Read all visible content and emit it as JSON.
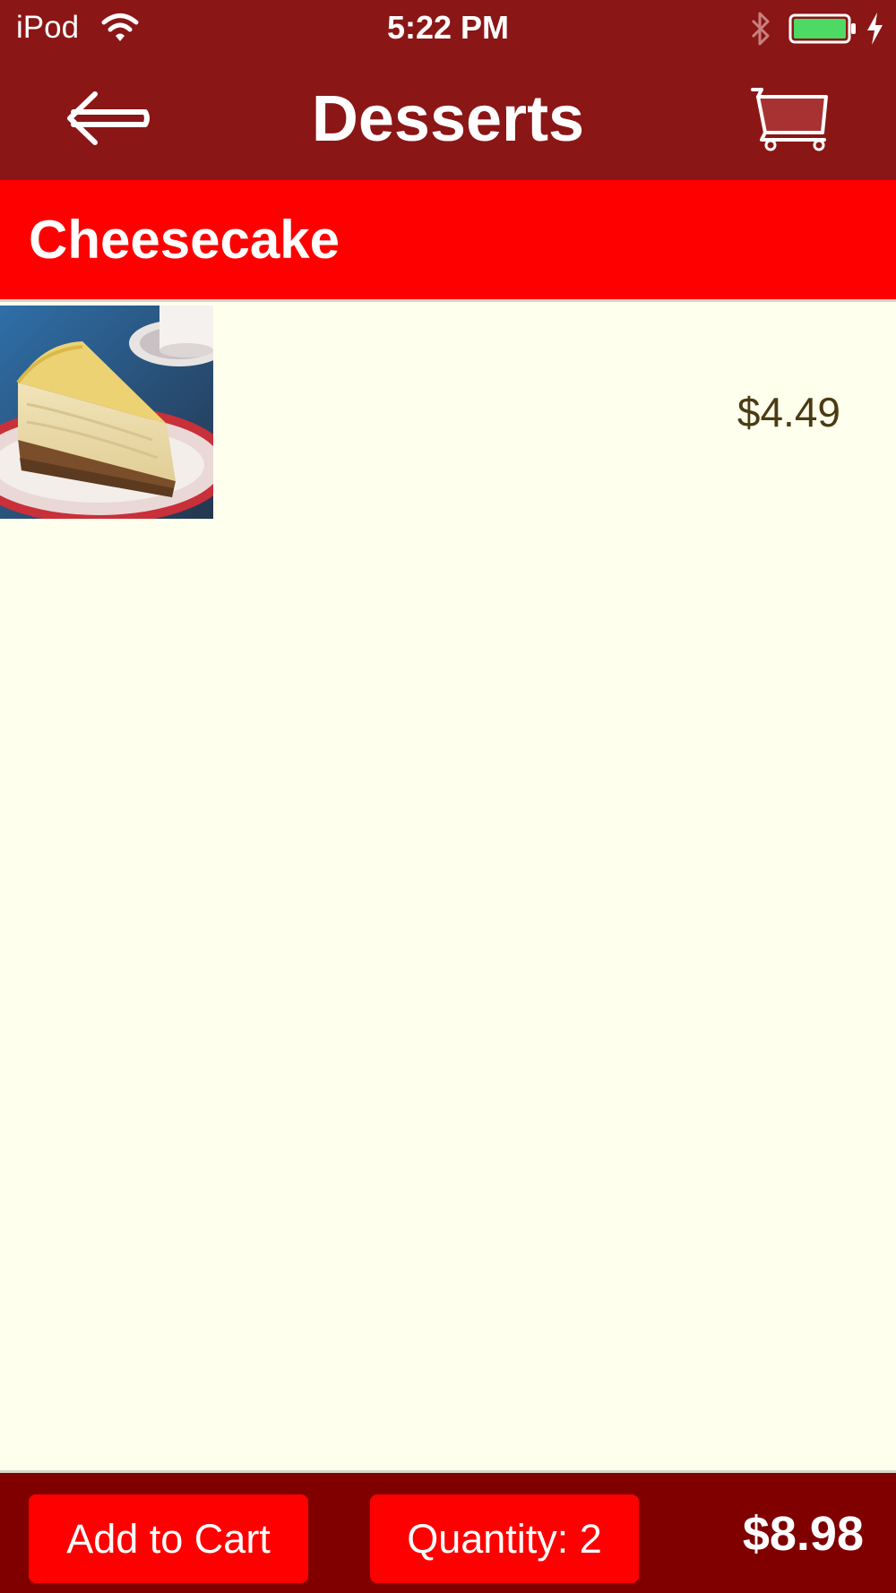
{
  "status_bar": {
    "carrier": "iPod",
    "time": "5:22 PM",
    "icons": [
      "wifi-icon",
      "bluetooth-icon",
      "battery-icon",
      "charging-bolt-icon"
    ]
  },
  "nav_bar": {
    "title": "Desserts",
    "back_icon": "back-arrow-icon",
    "cart_icon": "shopping-cart-icon"
  },
  "section": {
    "title": "Cheesecake"
  },
  "items": [
    {
      "image": "cheesecake-slice-photo",
      "price": "$4.49"
    }
  ],
  "toolbar": {
    "add_to_cart_label": "Add to Cart",
    "quantity_label": "Quantity: 2",
    "total": "$8.98"
  },
  "colors": {
    "nav_bg": "#8B1616",
    "section_bg": "#FF0000",
    "content_bg": "#FFFFEE",
    "toolbar_bg": "#800000",
    "button_bg": "#FF0000",
    "price_text": "#4A3B12",
    "battery_fill": "#4CD964"
  }
}
